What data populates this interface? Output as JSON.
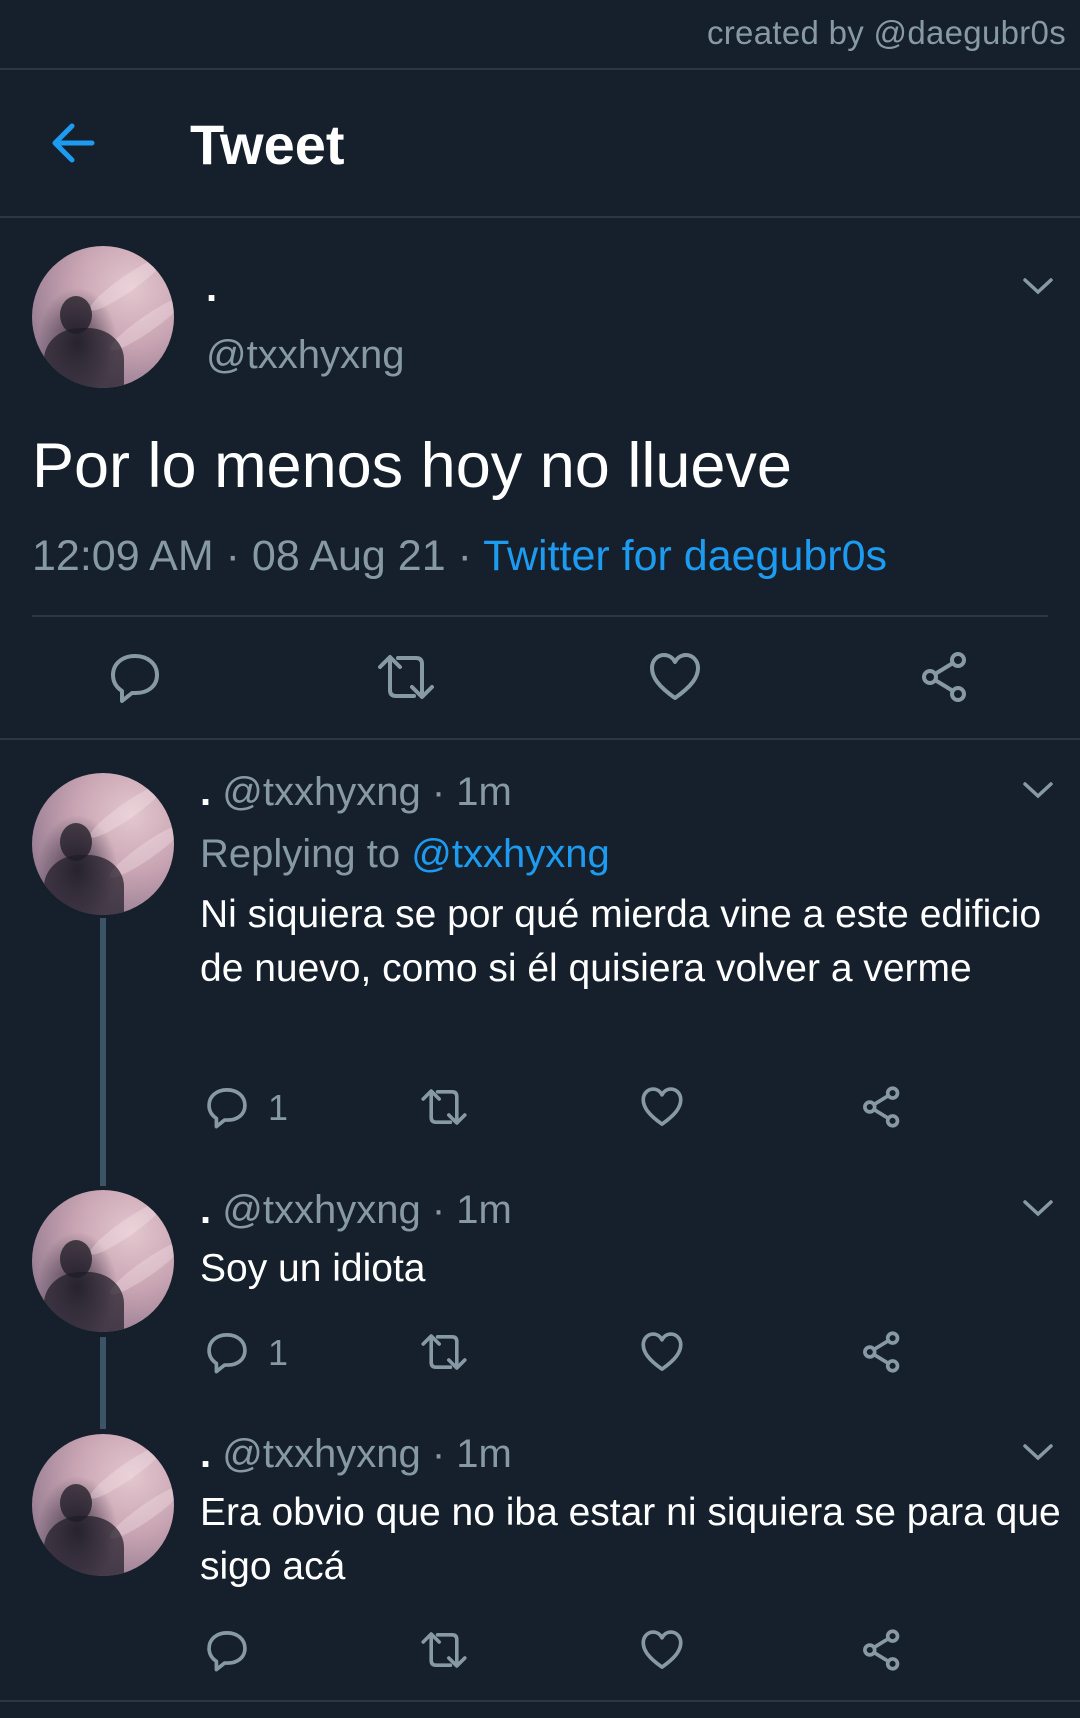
{
  "credit": "created by @daegubr0s",
  "header": {
    "title": "Tweet",
    "back_icon": "arrow-left-icon"
  },
  "colors": {
    "background": "#16202c",
    "accent": "#1d9bf0",
    "muted": "#8899a6",
    "divider": "#2b3843"
  },
  "main_tweet": {
    "name": ".",
    "handle": "@txxhyxng",
    "text": "Por lo menos hoy no llueve",
    "time": "12:09 AM",
    "sep1": "·",
    "date": "08 Aug 21",
    "sep2": "·",
    "source": "Twitter for daegubr0s"
  },
  "replies": [
    {
      "name": ".",
      "meta": "@txxhyxng · 1m",
      "replying_prefix": "Replying to",
      "replying_handle": "@txxhyxng",
      "text": "Ni siquiera se por qué mierda vine a este edificio de nuevo, como si él quisiera volver a verme",
      "reply_count": "1"
    },
    {
      "name": ".",
      "meta": "@txxhyxng · 1m",
      "text": "Soy un idiota",
      "reply_count": "1"
    },
    {
      "name": ".",
      "meta": "@txxhyxng · 1m",
      "text": "Era obvio que no iba estar ni siquiera se para que sigo acá",
      "reply_count": ""
    }
  ]
}
